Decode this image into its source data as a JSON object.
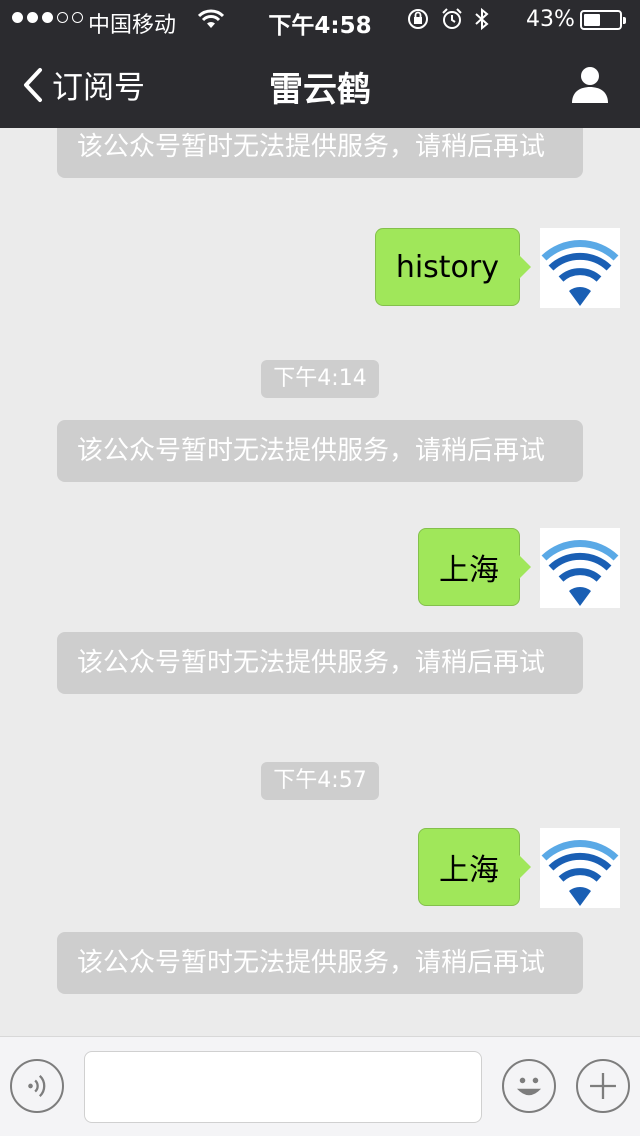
{
  "status_bar": {
    "signal_bars": [
      true,
      true,
      true,
      false,
      false
    ],
    "carrier": "中国移动",
    "time": "下午4:58",
    "battery_percent": "43%",
    "battery_level": 0.43,
    "icons": [
      "wifi-icon",
      "orientation-lock-icon",
      "alarm-icon",
      "bluetooth-icon",
      "battery-icon"
    ]
  },
  "nav": {
    "back_label": "订阅号",
    "title": "雷云鹤",
    "right_icon": "profile-icon"
  },
  "messages": [
    {
      "type": "system",
      "text": "该公众号暂时无法提供服务，请稍后再试"
    },
    {
      "type": "outgoing",
      "text": "history"
    },
    {
      "type": "timestamp",
      "text": "下午4:14"
    },
    {
      "type": "system",
      "text": "该公众号暂时无法提供服务，请稍后再试"
    },
    {
      "type": "outgoing",
      "text": "上海"
    },
    {
      "type": "system",
      "text": "该公众号暂时无法提供服务，请稍后再试"
    },
    {
      "type": "timestamp",
      "text": "下午4:57"
    },
    {
      "type": "outgoing",
      "text": "上海"
    },
    {
      "type": "system",
      "text": "该公众号暂时无法提供服务，请稍后再试"
    }
  ],
  "input_bar": {
    "voice_icon": "voice-icon",
    "text_value": "",
    "emoji_icon": "emoji-icon",
    "plus_icon": "plus-icon"
  },
  "colors": {
    "nav_bg": "#2b2b2f",
    "chat_bg": "#ebebeb",
    "bubble_green": "#a0e75a",
    "system_bubble": "#cecece",
    "avatar_wifi_blue": "#1a5fb4"
  }
}
